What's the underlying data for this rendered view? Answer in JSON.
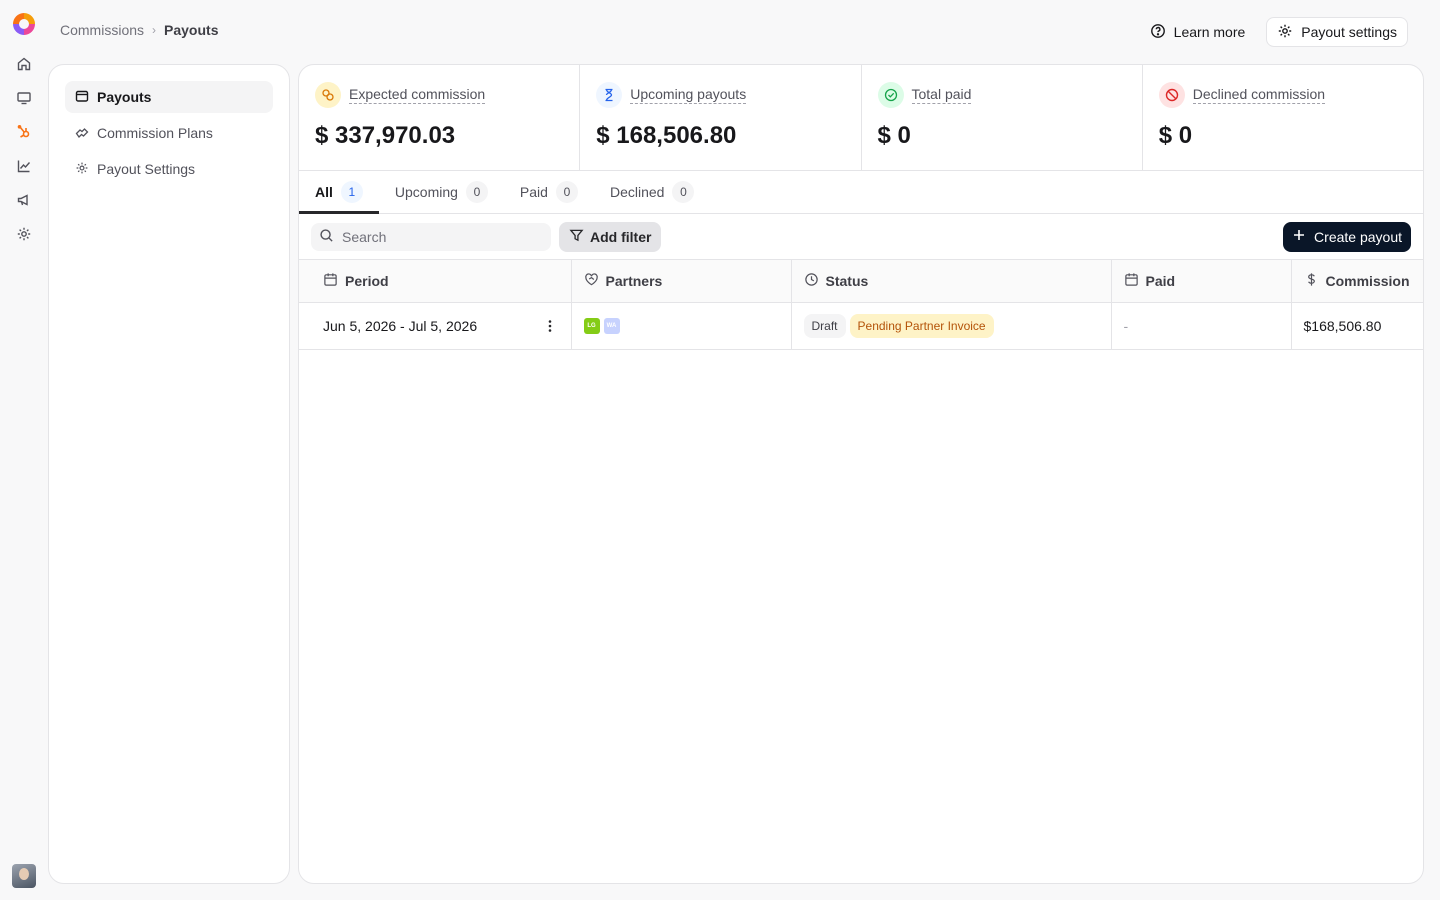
{
  "breadcrumb": {
    "parent": "Commissions",
    "separator": "›",
    "current": "Payouts"
  },
  "header": {
    "learn_more": "Learn more",
    "payout_settings": "Payout settings"
  },
  "nav": {
    "items": [
      {
        "label": "Payouts",
        "icon": "wallet-icon",
        "active": true
      },
      {
        "label": "Commission Plans",
        "icon": "handshake-icon",
        "active": false
      },
      {
        "label": "Payout Settings",
        "icon": "gear-icon",
        "active": false
      }
    ]
  },
  "rail": {
    "icons": [
      "home-icon",
      "monitor-icon",
      "hubspot-icon",
      "chart-icon",
      "megaphone-icon",
      "settings-icon"
    ]
  },
  "stats": [
    {
      "label": "Expected commission",
      "value": "$ 337,970.03",
      "icon": "coins-icon",
      "icon_bg": "#fef3c7",
      "icon_color": "#d97706"
    },
    {
      "label": "Upcoming payouts",
      "value": "$ 168,506.80",
      "icon": "hourglass-icon",
      "icon_bg": "#eff6ff",
      "icon_color": "#2563eb"
    },
    {
      "label": "Total paid",
      "value": "$ 0",
      "icon": "check-circle-icon",
      "icon_bg": "#dcfce7",
      "icon_color": "#16a34a"
    },
    {
      "label": "Declined commission",
      "value": "$ 0",
      "icon": "ban-icon",
      "icon_bg": "#fee2e2",
      "icon_color": "#dc2626"
    }
  ],
  "tabs": [
    {
      "label": "All",
      "count": "1",
      "active": true
    },
    {
      "label": "Upcoming",
      "count": "0",
      "active": false
    },
    {
      "label": "Paid",
      "count": "0",
      "active": false
    },
    {
      "label": "Declined",
      "count": "0",
      "active": false
    }
  ],
  "toolbar": {
    "search_placeholder": "Search",
    "add_filter": "Add filter",
    "create_payout": "Create payout"
  },
  "table": {
    "columns": [
      "Period",
      "Partners",
      "Status",
      "Paid",
      "Commission"
    ],
    "rows": [
      {
        "period": "Jun 5, 2026 - Jul 5, 2026",
        "partners": [
          {
            "initials": "LG",
            "color": "#84cc16"
          },
          {
            "initials": "WA",
            "color": "#c7d2fe"
          }
        ],
        "status": "Draft",
        "substatus": "Pending Partner Invoice",
        "paid": "-",
        "commission": "$168,506.80"
      }
    ]
  }
}
